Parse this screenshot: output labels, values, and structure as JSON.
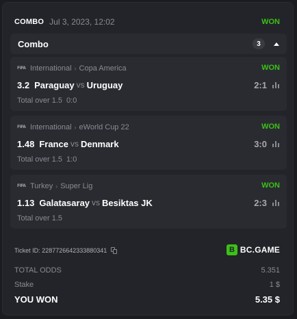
{
  "header": {
    "type": "COMBO",
    "date": "Jul 3, 2023, 12:02",
    "status": "WON"
  },
  "combo": {
    "title": "Combo",
    "count": "3"
  },
  "legs": [
    {
      "league": "International",
      "tournament": "Copa America",
      "status": "WON",
      "odds": "3.2",
      "home": "Paraguay",
      "vs": "vs",
      "away": "Uruguay",
      "score": "2:1",
      "market": "Total over 1.5",
      "pick": "0:0",
      "icon": "fifa-icon"
    },
    {
      "league": "International",
      "tournament": "eWorld Cup 22",
      "status": "WON",
      "odds": "1.48",
      "home": "France",
      "vs": "vs",
      "away": "Denmark",
      "score": "3:0",
      "market": "Total over 1.5",
      "pick": "1:0",
      "icon": "fifa-icon"
    },
    {
      "league": "Turkey",
      "tournament": "Super Lig",
      "status": "WON",
      "odds": "1.13",
      "home": "Galatasaray",
      "vs": "vs",
      "away": "Besiktas JK",
      "score": "2:3",
      "market": "Total over 1.5",
      "pick": "",
      "icon": "fifa-icon"
    }
  ],
  "ticket": {
    "label": "Ticket ID:",
    "id": "2287726642333880341"
  },
  "brand": {
    "mark": "B",
    "name": "BC.GAME"
  },
  "summary": {
    "total_odds_label": "TOTAL ODDS",
    "total_odds": "5.351",
    "stake_label": "Stake",
    "stake": "1 $",
    "won_label": "YOU WON",
    "won": "5.35 $"
  },
  "colors": {
    "accent": "#3bc117",
    "background": "#1b1c20",
    "card": "#232429",
    "panel": "#2a2b31"
  }
}
